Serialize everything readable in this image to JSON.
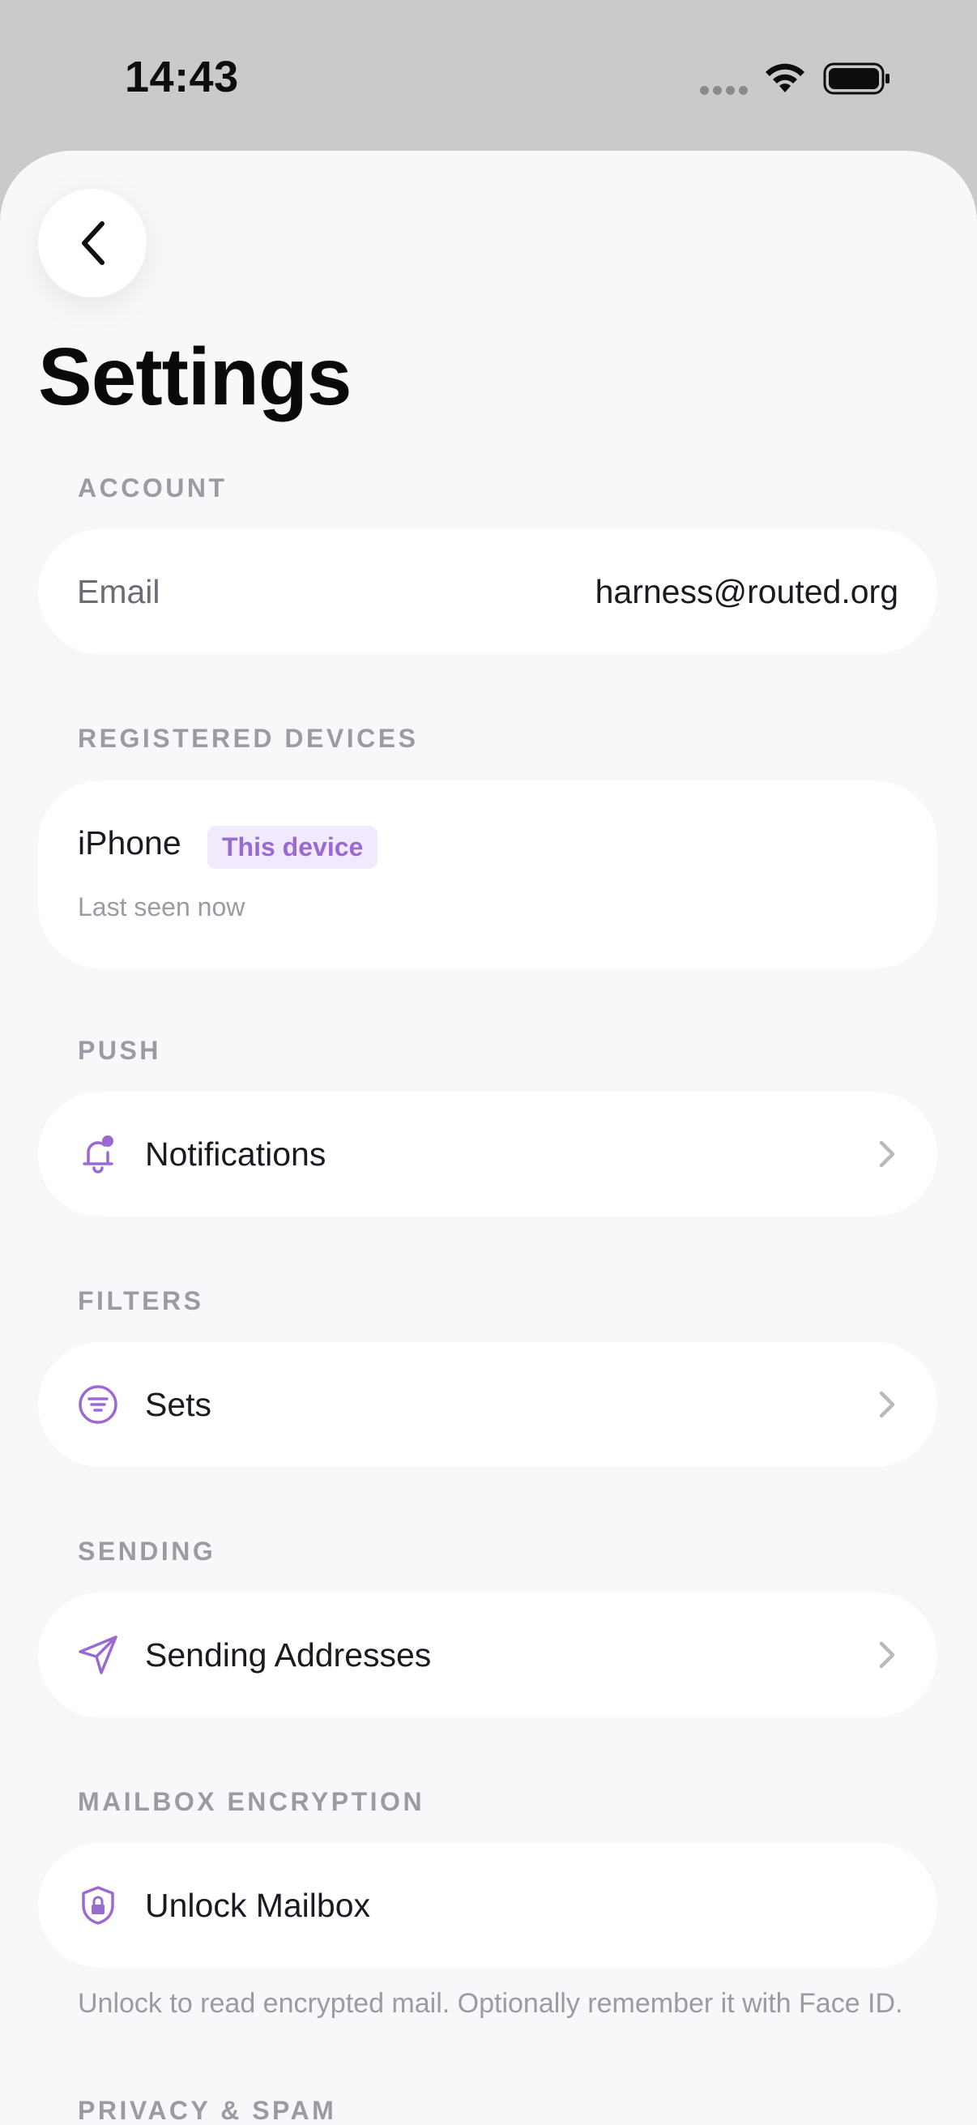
{
  "status": {
    "time": "14:43"
  },
  "page": {
    "title": "Settings"
  },
  "sections": {
    "account": {
      "label": "ACCOUNT",
      "email_label": "Email",
      "email_value": "harness@routed.org"
    },
    "devices": {
      "label": "REGISTERED DEVICES",
      "device_name": "iPhone",
      "device_badge": "This device",
      "device_status": "Last seen now"
    },
    "push": {
      "label": "PUSH",
      "item_label": "Notifications",
      "icon": "bell-icon"
    },
    "filters": {
      "label": "FILTERS",
      "item_label": "Sets",
      "icon": "filter-icon"
    },
    "sending": {
      "label": "SENDING",
      "item_label": "Sending Addresses",
      "icon": "paper-plane-icon"
    },
    "encryption": {
      "label": "MAILBOX ENCRYPTION",
      "item_label": "Unlock Mailbox",
      "icon": "shield-lock-icon",
      "helper": "Unlock to read encrypted mail. Optionally remember it with Face ID."
    },
    "privacy": {
      "label": "PRIVACY & SPAM"
    }
  },
  "colors": {
    "accent": "#9a6ad2",
    "background": "#f7f8fa",
    "section_label": "#9a9ba3",
    "badge_bg": "#f1eafc"
  }
}
